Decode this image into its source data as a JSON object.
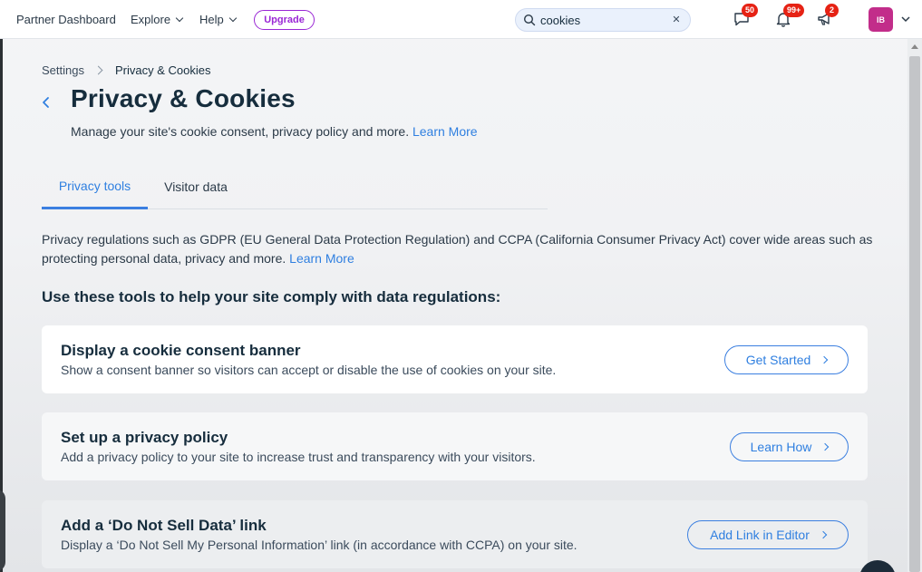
{
  "topbar": {
    "brand": "Partner Dashboard",
    "explore": "Explore",
    "help": "Help",
    "upgrade": "Upgrade",
    "search": {
      "value": "cookies",
      "placeholder": ""
    },
    "clear_icon": "close-icon",
    "notifications": {
      "messages": "50",
      "alerts": "99+",
      "announcements": "2"
    },
    "avatar_initials": "IB"
  },
  "breadcrumb": {
    "root": "Settings",
    "current": "Privacy & Cookies"
  },
  "page": {
    "title": "Privacy & Cookies",
    "subtitle": "Manage your site's cookie consent, privacy policy and more.",
    "subtitle_link": "Learn More"
  },
  "tabs": [
    {
      "label": "Privacy tools",
      "active": true
    },
    {
      "label": "Visitor data",
      "active": false
    }
  ],
  "intro": {
    "text": "Privacy regulations such as GDPR (EU General Data Protection Regulation) and CCPA (California Consumer Privacy Act) cover wide areas such as protecting personal data, privacy and more.",
    "link": "Learn More"
  },
  "section_heading": "Use these tools to help your site comply with data regulations:",
  "cards": [
    {
      "title": "Display a cookie consent banner",
      "description": "Show a consent banner so visitors can accept or disable the use of cookies on your site.",
      "button": "Get Started"
    },
    {
      "title": "Set up a privacy policy",
      "description": "Add a privacy policy to your site to increase trust and transparency with your visitors.",
      "button": "Learn How"
    },
    {
      "title": "Add a ‘Do Not Sell Data’ link",
      "description": "Display a ‘Do Not Sell My Personal Information’ link (in accordance with CCPA) on your site.",
      "button": "Add Link in Editor"
    }
  ],
  "colors": {
    "accent": "#2f7fe0",
    "upgrade": "#9a27d5",
    "badge": "#e62214",
    "avatar": "#c22d8a",
    "text": "#162d3d"
  }
}
